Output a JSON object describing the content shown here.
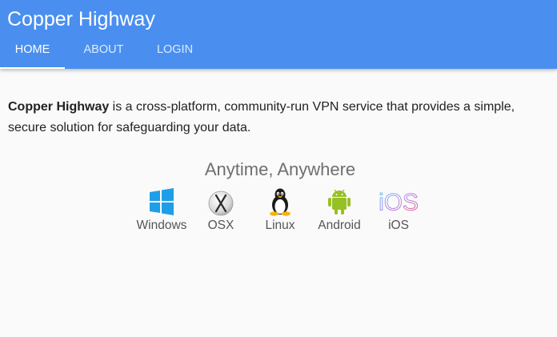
{
  "header": {
    "title": "Copper Highway",
    "tabs": [
      {
        "label": "HOME",
        "active": true
      },
      {
        "label": "ABOUT",
        "active": false
      },
      {
        "label": "LOGIN",
        "active": false
      }
    ],
    "accent_color": "#4a8ff0"
  },
  "main": {
    "intro_bold": "Copper Highway",
    "intro_rest": " is a cross-platform, community-run VPN service that provides a simple, secure solution for safeguarding your data.",
    "tagline": "Anytime, Anywhere",
    "platforms": [
      {
        "label": "Windows",
        "icon": "windows-icon"
      },
      {
        "label": "OSX",
        "icon": "osx-icon"
      },
      {
        "label": "Linux",
        "icon": "linux-tux-icon"
      },
      {
        "label": "Android",
        "icon": "android-icon"
      },
      {
        "label": "iOS",
        "icon": "ios-icon"
      }
    ]
  }
}
